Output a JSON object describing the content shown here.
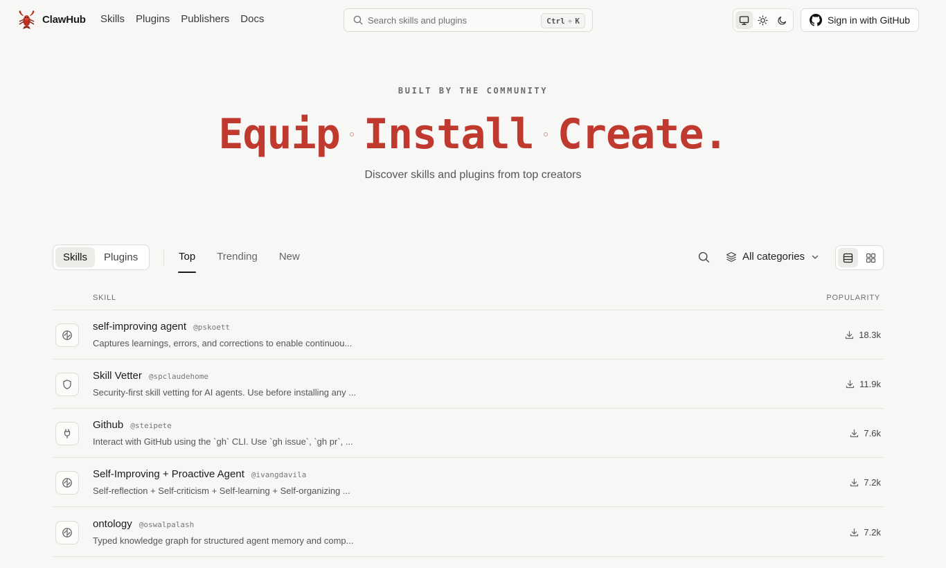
{
  "brand": {
    "name": "ClawHub",
    "logo": "lobster-logo"
  },
  "nav": {
    "links": [
      "Skills",
      "Plugins",
      "Publishers",
      "Docs"
    ]
  },
  "search": {
    "placeholder": "Search skills and plugins",
    "shortcut_key1": "Ctrl",
    "shortcut_plus": "+",
    "shortcut_key2": "K"
  },
  "theme": {
    "options": [
      "monitor-icon",
      "sun-icon",
      "moon-icon"
    ],
    "selected": "monitor-icon"
  },
  "signin": {
    "label": "Sign in with GitHub",
    "icon": "github-icon"
  },
  "hero": {
    "eyebrow": "BUILT BY THE COMMUNITY",
    "headline_words": [
      "Equip",
      "Install",
      "Create."
    ],
    "subtitle": "Discover skills and plugins from top creators"
  },
  "toolbar": {
    "type_toggle": [
      "Skills",
      "Plugins"
    ],
    "type_selected": "Skills",
    "tabs": [
      "Top",
      "Trending",
      "New"
    ],
    "tab_selected": "Top",
    "category_label": "All categories",
    "view_modes": [
      "list-view-icon",
      "grid-view-icon"
    ],
    "view_selected": "list-view-icon"
  },
  "table": {
    "col_skill": "SKILL",
    "col_popularity": "POPULARITY",
    "rows": [
      {
        "name": "self-improving agent",
        "author": "@pskoett",
        "description": "Captures learnings, errors, and corrections to enable continuou...",
        "downloads": "18.3k",
        "icon": "brain-icon"
      },
      {
        "name": "Skill Vetter",
        "author": "@spclaudehome",
        "description": "Security-first skill vetting for AI agents. Use before installing any ...",
        "downloads": "11.9k",
        "icon": "shield-icon"
      },
      {
        "name": "Github",
        "author": "@steipete",
        "description": "Interact with GitHub using the `gh` CLI. Use `gh issue`, `gh pr`, ...",
        "downloads": "7.6k",
        "icon": "plug-icon"
      },
      {
        "name": "Self-Improving + Proactive Agent",
        "author": "@ivangdavila",
        "description": "Self-reflection + Self-criticism + Self-learning + Self-organizing ...",
        "downloads": "7.2k",
        "icon": "brain-icon"
      },
      {
        "name": "ontology",
        "author": "@oswalpalash",
        "description": "Typed knowledge graph for structured agent memory and comp...",
        "downloads": "7.2k",
        "icon": "brain-icon"
      }
    ]
  },
  "colors": {
    "accent": "#c0392e",
    "background": "#f7f7f6",
    "border": "#dcdcd8"
  }
}
